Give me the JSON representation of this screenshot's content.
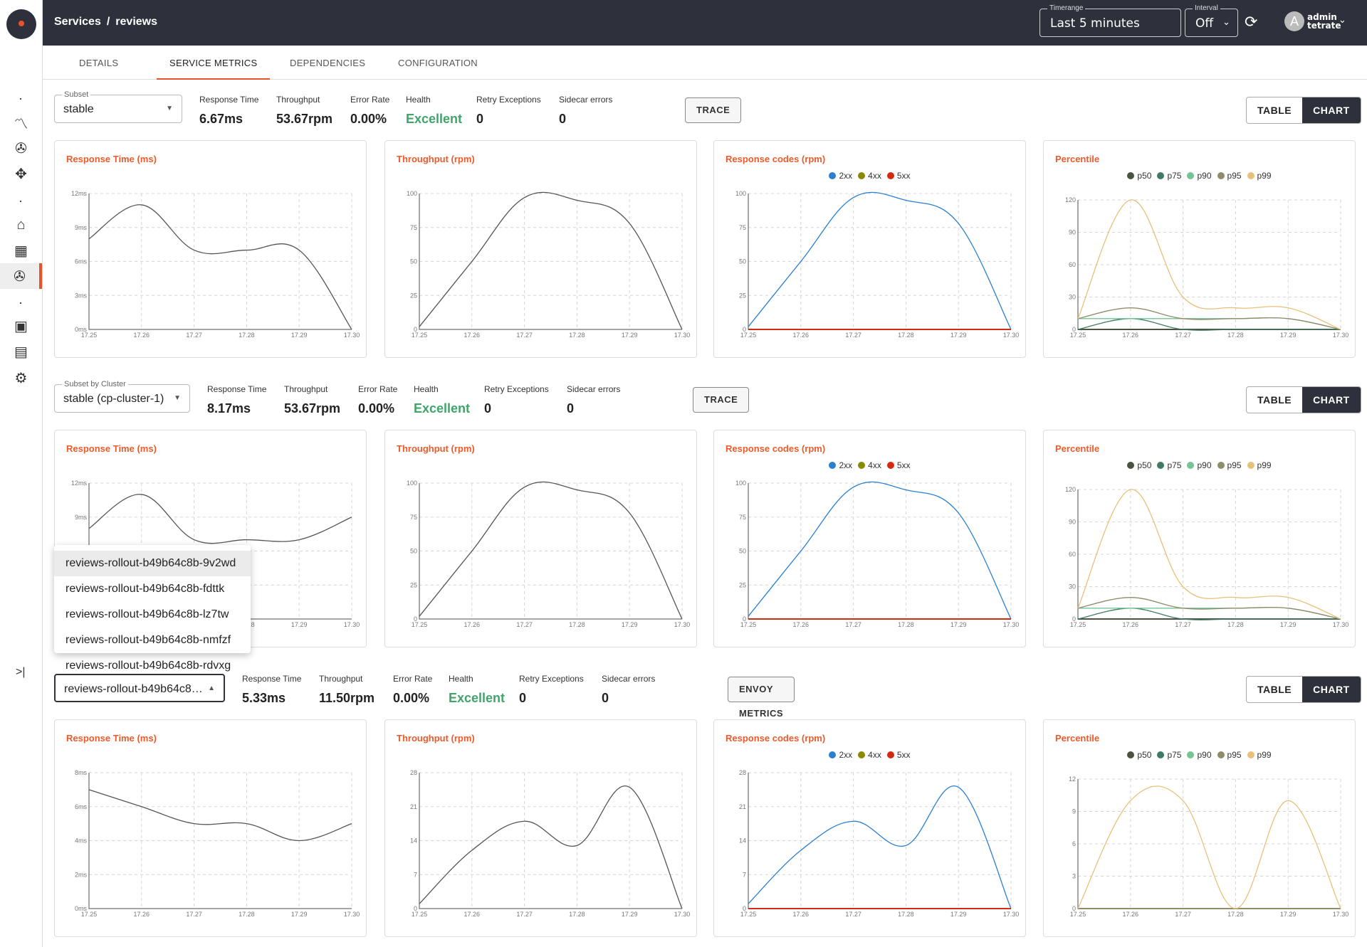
{
  "header": {
    "breadcrumb": [
      "Services",
      "/",
      "reviews"
    ],
    "timerange_label": "Timerange",
    "timerange_value": "Last 5 minutes",
    "interval_label": "Interval",
    "interval_value": "Off",
    "user_initial": "A",
    "user_name": "admin",
    "user_org": "tetrate"
  },
  "tabs": [
    {
      "label": "DETAILS"
    },
    {
      "label": "SERVICE METRICS",
      "active": true
    },
    {
      "label": "DEPENDENCIES"
    },
    {
      "label": "CONFIGURATION"
    }
  ],
  "sidebar": {
    "icons": [
      "trending-icon",
      "services-icon",
      "extension-icon",
      "bank-icon",
      "grid-icon",
      "services-icon",
      "badge-icon",
      "calendar-icon",
      "gear-icon"
    ],
    "active": "services-icon",
    "accent": "#e8542a"
  },
  "view_toggle": {
    "table": "TABLE",
    "chart": "CHART",
    "selected": "CHART"
  },
  "dropdown_menu": {
    "items": [
      "reviews-rollout-b49b64c8b-9v2wd",
      "reviews-rollout-b49b64c8b-fdttk",
      "reviews-rollout-b49b64c8b-lz7tw",
      "reviews-rollout-b49b64c8b-nmfzf",
      "reviews-rollout-b49b64c8b-rdvxg"
    ],
    "highlighted": 0
  },
  "rows": [
    {
      "select_label": "Subset",
      "select_value": "stable",
      "open": false,
      "metrics": [
        {
          "k": "Response Time",
          "v": "6.67ms"
        },
        {
          "k": "Throughput",
          "v": "53.67rpm"
        },
        {
          "k": "Error Rate",
          "v": "0.00%"
        },
        {
          "k": "Health",
          "v": "Excellent"
        },
        {
          "k": "Retry Exceptions",
          "v": "0"
        },
        {
          "k": "Sidecar errors",
          "v": "0"
        }
      ],
      "button": "TRACE"
    },
    {
      "select_label": "Subset by Cluster",
      "select_value": "stable (cp-cluster-1)",
      "open": false,
      "metrics": [
        {
          "k": "Response Time",
          "v": "8.17ms"
        },
        {
          "k": "Throughput",
          "v": "53.67rpm"
        },
        {
          "k": "Error Rate",
          "v": "0.00%"
        },
        {
          "k": "Health",
          "v": "Excellent"
        },
        {
          "k": "Retry Exceptions",
          "v": "0"
        },
        {
          "k": "Sidecar errors",
          "v": "0"
        }
      ],
      "button": "TRACE"
    },
    {
      "select_label": "",
      "select_value": "reviews-rollout-b49b64c8…",
      "open": true,
      "metrics": [
        {
          "k": "Response Time",
          "v": "5.33ms"
        },
        {
          "k": "Throughput",
          "v": "11.50rpm"
        },
        {
          "k": "Error Rate",
          "v": "0.00%"
        },
        {
          "k": "Health",
          "v": "Excellent"
        },
        {
          "k": "Retry Exceptions",
          "v": "0"
        },
        {
          "k": "Sidecar errors",
          "v": "0"
        }
      ],
      "button": "ENVOY METRICS"
    }
  ],
  "chart_data": [
    {
      "type": "line",
      "title": "Response Time (ms)",
      "x": [
        "17.25",
        "17.26",
        "17.27",
        "17.28",
        "17.29",
        "17.30"
      ],
      "yticks": [
        0,
        3,
        6,
        9,
        12
      ],
      "yunit": "ms",
      "series": [
        {
          "color": "#555555",
          "values": [
            8,
            11,
            7,
            7,
            7,
            0
          ]
        }
      ]
    },
    {
      "type": "line",
      "title": "Throughput (rpm)",
      "x": [
        "17.25",
        "17.26",
        "17.27",
        "17.28",
        "17.29",
        "17.30"
      ],
      "yticks": [
        0,
        25,
        50,
        75,
        100
      ],
      "series": [
        {
          "color": "#555555",
          "values": [
            2,
            50,
            97,
            95,
            78,
            0
          ]
        }
      ]
    },
    {
      "type": "line",
      "title": "Response codes (rpm)",
      "x": [
        "17.25",
        "17.26",
        "17.27",
        "17.28",
        "17.29",
        "17.30"
      ],
      "yticks": [
        0,
        25,
        50,
        75,
        100
      ],
      "series": [
        {
          "name": "2xx",
          "color": "#2a7fd0",
          "values": [
            2,
            50,
            97,
            95,
            78,
            0
          ]
        },
        {
          "name": "4xx",
          "color": "#8a8a00",
          "values": [
            0,
            0,
            0,
            0,
            0,
            0
          ]
        },
        {
          "name": "5xx",
          "color": "#d42a10",
          "values": [
            0,
            0,
            0,
            0,
            0,
            0
          ]
        }
      ]
    },
    {
      "type": "line",
      "title": "Percentile",
      "x": [
        "17.25",
        "17.26",
        "17.27",
        "17.28",
        "17.29",
        "17.30"
      ],
      "yticks": [
        0,
        30,
        60,
        90,
        120
      ],
      "series": [
        {
          "name": "p50",
          "color": "#4a5240",
          "values": [
            0,
            0,
            0,
            0,
            0,
            0
          ]
        },
        {
          "name": "p75",
          "color": "#3f7b63",
          "values": [
            0,
            10,
            0,
            0,
            0,
            0
          ]
        },
        {
          "name": "p90",
          "color": "#74c494",
          "values": [
            10,
            10,
            10,
            10,
            10,
            0
          ]
        },
        {
          "name": "p95",
          "color": "#8f8c6a",
          "values": [
            10,
            20,
            10,
            10,
            10,
            0
          ]
        },
        {
          "name": "p99",
          "color": "#e8c07a",
          "values": [
            10,
            120,
            30,
            20,
            20,
            0
          ]
        }
      ]
    },
    {
      "type": "line",
      "title": "Response Time (ms)",
      "x": [
        "17.25",
        "17.26",
        "17.27",
        "17.28",
        "17.29",
        "17.30"
      ],
      "yticks": [
        0,
        3,
        6,
        9,
        12
      ],
      "yunit": "ms",
      "series": [
        {
          "color": "#555555",
          "values": [
            8,
            11,
            7,
            7,
            7,
            9
          ]
        }
      ]
    },
    {
      "type": "line",
      "title": "Throughput (rpm)",
      "x": [
        "17.25",
        "17.26",
        "17.27",
        "17.28",
        "17.29",
        "17.30"
      ],
      "yticks": [
        0,
        25,
        50,
        75,
        100
      ],
      "series": [
        {
          "color": "#555555",
          "values": [
            2,
            50,
            97,
            95,
            78,
            0
          ]
        }
      ]
    },
    {
      "type": "line",
      "title": "Response codes (rpm)",
      "x": [
        "17.25",
        "17.26",
        "17.27",
        "17.28",
        "17.29",
        "17.30"
      ],
      "yticks": [
        0,
        25,
        50,
        75,
        100
      ],
      "series": [
        {
          "name": "2xx",
          "color": "#2a7fd0",
          "values": [
            2,
            50,
            97,
            95,
            78,
            0
          ]
        },
        {
          "name": "4xx",
          "color": "#8a8a00",
          "values": [
            0,
            0,
            0,
            0,
            0,
            0
          ]
        },
        {
          "name": "5xx",
          "color": "#d42a10",
          "values": [
            0,
            0,
            0,
            0,
            0,
            0
          ]
        }
      ]
    },
    {
      "type": "line",
      "title": "Percentile",
      "x": [
        "17.25",
        "17.26",
        "17.27",
        "17.28",
        "17.29",
        "17.30"
      ],
      "yticks": [
        0,
        30,
        60,
        90,
        120
      ],
      "series": [
        {
          "name": "p50",
          "color": "#4a5240",
          "values": [
            0,
            0,
            0,
            0,
            0,
            0
          ]
        },
        {
          "name": "p75",
          "color": "#3f7b63",
          "values": [
            0,
            10,
            0,
            0,
            0,
            0
          ]
        },
        {
          "name": "p90",
          "color": "#74c494",
          "values": [
            10,
            10,
            10,
            10,
            10,
            0
          ]
        },
        {
          "name": "p95",
          "color": "#8f8c6a",
          "values": [
            10,
            20,
            10,
            10,
            10,
            0
          ]
        },
        {
          "name": "p99",
          "color": "#e8c07a",
          "values": [
            10,
            120,
            30,
            20,
            20,
            0
          ]
        }
      ]
    },
    {
      "type": "line",
      "title": "Response Time (ms)",
      "x": [
        "17.25",
        "17.26",
        "17.27",
        "17.28",
        "17.29",
        "17.30"
      ],
      "yticks": [
        0,
        2,
        4,
        6,
        8
      ],
      "yunit": "ms",
      "series": [
        {
          "color": "#555555",
          "values": [
            7,
            6,
            5,
            5,
            4,
            5
          ]
        }
      ]
    },
    {
      "type": "line",
      "title": "Throughput (rpm)",
      "x": [
        "17.25",
        "17.26",
        "17.27",
        "17.28",
        "17.29",
        "17.30"
      ],
      "yticks": [
        0,
        7,
        14,
        21,
        28
      ],
      "series": [
        {
          "color": "#555555",
          "values": [
            1,
            12,
            18,
            13,
            25,
            0
          ]
        }
      ]
    },
    {
      "type": "line",
      "title": "Response codes (rpm)",
      "x": [
        "17.25",
        "17.26",
        "17.27",
        "17.28",
        "17.29",
        "17.30"
      ],
      "yticks": [
        0,
        7,
        14,
        21,
        28
      ],
      "series": [
        {
          "name": "2xx",
          "color": "#2a7fd0",
          "values": [
            1,
            12,
            18,
            13,
            25,
            0
          ]
        },
        {
          "name": "4xx",
          "color": "#8a8a00",
          "values": [
            0,
            0,
            0,
            0,
            0,
            0
          ]
        },
        {
          "name": "5xx",
          "color": "#d42a10",
          "values": [
            0,
            0,
            0,
            0,
            0,
            0
          ]
        }
      ]
    },
    {
      "type": "line",
      "title": "Percentile",
      "x": [
        "17.25",
        "17.26",
        "17.27",
        "17.28",
        "17.29",
        "17.30"
      ],
      "yticks": [
        0,
        3,
        6,
        9,
        12
      ],
      "series": [
        {
          "name": "p50",
          "color": "#4a5240",
          "values": [
            0,
            0,
            0,
            0,
            0,
            0
          ]
        },
        {
          "name": "p75",
          "color": "#3f7b63",
          "values": [
            0,
            0,
            0,
            0,
            0,
            0
          ]
        },
        {
          "name": "p90",
          "color": "#74c494",
          "values": [
            0,
            0,
            0,
            0,
            0,
            0
          ]
        },
        {
          "name": "p95",
          "color": "#8f8c6a",
          "values": [
            0,
            0,
            0,
            0,
            0,
            0
          ]
        },
        {
          "name": "p99",
          "color": "#e8c07a",
          "values": [
            0,
            10,
            10,
            0,
            10,
            0
          ]
        }
      ]
    }
  ]
}
